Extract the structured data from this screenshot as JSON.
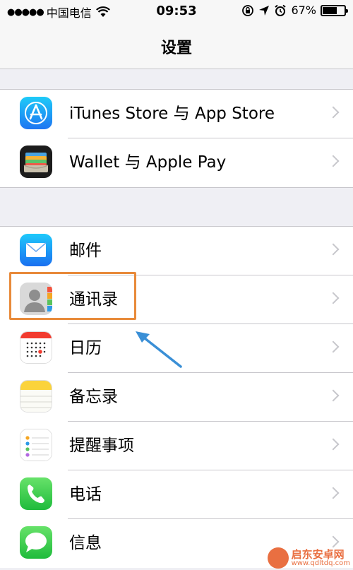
{
  "status_bar": {
    "signal": "●●●●●",
    "carrier": "中国电信",
    "time": "09:53",
    "battery_percent": "67%",
    "battery_level": 0.67
  },
  "nav": {
    "title": "设置"
  },
  "groups": [
    {
      "items": [
        {
          "label": "iTunes Store 与 App Store",
          "icon": "app-store-icon"
        },
        {
          "label": "Wallet 与 Apple Pay",
          "icon": "wallet-icon"
        }
      ]
    },
    {
      "items": [
        {
          "label": "邮件",
          "icon": "mail-icon"
        },
        {
          "label": "通讯录",
          "icon": "contacts-icon"
        },
        {
          "label": "日历",
          "icon": "calendar-icon"
        },
        {
          "label": "备忘录",
          "icon": "notes-icon"
        },
        {
          "label": "提醒事项",
          "icon": "reminders-icon"
        },
        {
          "label": "电话",
          "icon": "phone-icon"
        },
        {
          "label": "信息",
          "icon": "messages-icon"
        }
      ]
    }
  ],
  "watermark": {
    "title": "启东安卓网",
    "url": "www.qdltdq.com"
  },
  "colors": {
    "highlight": "#e88a3a",
    "arrow": "#3a8fd6",
    "background": "#efeff4",
    "separator": "#c8c7cc"
  }
}
